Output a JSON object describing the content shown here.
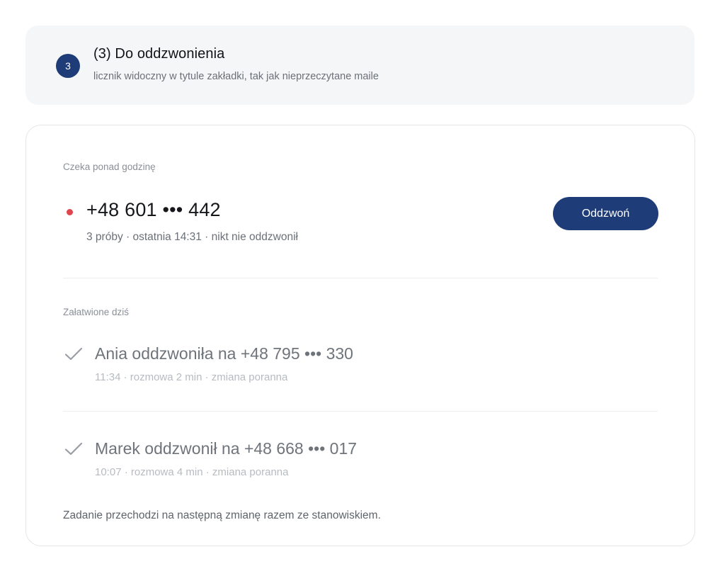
{
  "tab_preview": {
    "badge": "3",
    "title": "(3) Do oddzwonienia",
    "subtitle": "licznik widoczny w tytule zakładki, tak jak nieprzeczytane maile"
  },
  "waiting": {
    "label": "Czeka ponad godzinę",
    "number": "+48 601 ••• 442",
    "meta": "3 próby · ostatnia 14:31 · nikt nie oddzwonił",
    "button_label": "Oddzwoń",
    "status_color": "#e0454f"
  },
  "resolved": {
    "label": "Załatwione dziś",
    "items": [
      {
        "title": "Ania oddzwoniła na +48 795 ••• 330",
        "meta": "11:34 · rozmowa 2 min · zmiana poranna",
        "icon": "check-icon"
      },
      {
        "title": "Marek oddzwonił na +48 668 ••• 017",
        "meta": "10:07 · rozmowa 4 min · zmiana poranna",
        "icon": "check-icon"
      }
    ]
  },
  "footer": {
    "note": "Zadanie przechodzi na następną zmianę razem ze stanowiskiem."
  },
  "colors": {
    "accent": "#1d3c78",
    "alert": "#e0454f"
  }
}
